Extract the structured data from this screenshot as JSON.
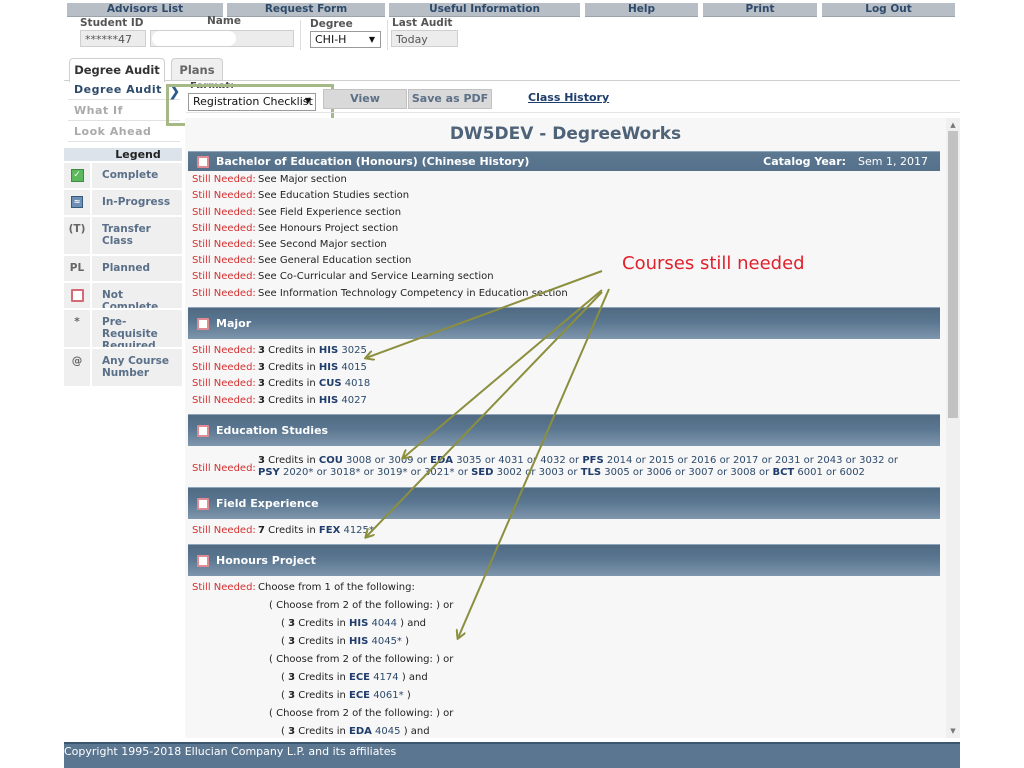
{
  "nav": {
    "items": [
      {
        "label": "Advisors List"
      },
      {
        "label": "Request Form"
      },
      {
        "label": "Useful Information"
      },
      {
        "label": "Help"
      },
      {
        "label": "Print"
      },
      {
        "label": "Log Out"
      }
    ]
  },
  "student": {
    "id_label": "Student ID",
    "id_value": "******47",
    "name_label": "Name",
    "name_value": "",
    "degree_label": "Degree",
    "degree_value": "CHI-H",
    "last_audit_label": "Last Audit",
    "last_audit_value": "Today"
  },
  "tabs": [
    {
      "label": "Degree Audit",
      "active": true
    },
    {
      "label": "Plans",
      "active": false
    }
  ],
  "subnav": [
    {
      "label": "Degree Audit",
      "active": true
    },
    {
      "label": "What If",
      "active": false
    },
    {
      "label": "Look Ahead",
      "active": false
    }
  ],
  "toolbar": {
    "format_label": "Format:",
    "format_value": "Registration Checklist",
    "view_label": "View",
    "pdf_label": "Save as PDF",
    "class_history_label": "Class History"
  },
  "legend": {
    "title": "Legend",
    "items": [
      {
        "icon": "complete-check-icon",
        "label": "Complete"
      },
      {
        "icon": "in-progress-icon",
        "label": "In-Progress"
      },
      {
        "symbol": "(T)",
        "label": "Transfer Class"
      },
      {
        "symbol": "PL",
        "label": "Planned"
      },
      {
        "icon": "not-complete-icon",
        "label": "Not Complete"
      },
      {
        "symbol": "*",
        "label": "Pre-Requisite Required"
      },
      {
        "symbol": "@",
        "label": "Any Course Number"
      }
    ]
  },
  "main": {
    "title": "DW5DEV - DegreeWorks",
    "degree_block": {
      "title": "Bachelor of Education (Honours) (Chinese History)",
      "catalog_label": "Catalog Year:",
      "catalog_value": "Sem 1, 2017",
      "still_needed_label": "Still Needed:",
      "items": [
        "See Major section",
        "See Education Studies section",
        "See Field Experience section",
        "See Honours Project section",
        "See Second Major section",
        "See General Education section",
        "See Co-Curricular and Service Learning section",
        "See Information Technology Competency in Education section"
      ]
    },
    "major": {
      "title": "Major",
      "items": [
        {
          "credits": "3",
          "mid": " Credits in ",
          "subject": "HIS",
          "course": " 3025"
        },
        {
          "credits": "3",
          "mid": " Credits in ",
          "subject": "HIS",
          "course": " 4015"
        },
        {
          "credits": "3",
          "mid": " Credits in ",
          "subject": "CUS",
          "course": " 4018"
        },
        {
          "credits": "3",
          "mid": " Credits in ",
          "subject": "HIS",
          "course": " 4027"
        }
      ]
    },
    "education_studies": {
      "title": "Education Studies",
      "credits": "3",
      "parts": [
        {
          "t": " Credits in "
        },
        {
          "s": "COU"
        },
        {
          "c": " 3008 or 3009 or "
        },
        {
          "s": "EDA"
        },
        {
          "c": " 3035 or 4031 or 4032 or "
        },
        {
          "s": "PFS"
        },
        {
          "c": " 2014 or 2015 or 2016 or 2017 or 2031 or 2043 or 3032 or "
        },
        {
          "s": "PSY"
        },
        {
          "c": " 2020* or 3018* or 3019* or 3021* or "
        },
        {
          "s": "SED"
        },
        {
          "c": " 3002 or 3003 or "
        },
        {
          "s": "TLS"
        },
        {
          "c": " 3005 or 3006 or 3007 or 3008 or "
        },
        {
          "s": "BCT"
        },
        {
          "c": " 6001 or 6002"
        }
      ]
    },
    "field_experience": {
      "title": "Field Experience",
      "credits": "7",
      "mid": " Credits in ",
      "subject": "FEX",
      "course": " 4125*"
    },
    "honours_project": {
      "title": "Honours Project",
      "intro": "Choose from 1 of the following:",
      "lines": [
        {
          "level": 1,
          "text": "( Choose from 2 of the following: ) or"
        },
        {
          "level": 2,
          "pre": "( ",
          "credits": "3",
          "mid": " Credits in ",
          "subject": "HIS",
          "course": " 4044",
          "post": " ) and"
        },
        {
          "level": 2,
          "pre": "( ",
          "credits": "3",
          "mid": " Credits in ",
          "subject": "HIS",
          "course": " 4045*",
          "post": " )"
        },
        {
          "level": 1,
          "text": "( Choose from 2 of the following: ) or"
        },
        {
          "level": 2,
          "pre": "( ",
          "credits": "3",
          "mid": " Credits in ",
          "subject": "ECE",
          "course": " 4174",
          "post": " ) and"
        },
        {
          "level": 2,
          "pre": "( ",
          "credits": "3",
          "mid": " Credits in ",
          "subject": "ECE",
          "course": " 4061*",
          "post": " )"
        },
        {
          "level": 1,
          "text": "( Choose from 2 of the following: ) or"
        },
        {
          "level": 2,
          "pre": "( ",
          "credits": "3",
          "mid": " Credits in ",
          "subject": "EDA",
          "course": " 4045",
          "post": " ) and"
        }
      ]
    }
  },
  "annotation": {
    "text": "Courses still needed",
    "color": "#e0212d",
    "arrow_color": "#8b8f3e"
  },
  "footer": {
    "text": "Copyright 1995-2018 Ellucian Company L.P. and its affiliates"
  }
}
